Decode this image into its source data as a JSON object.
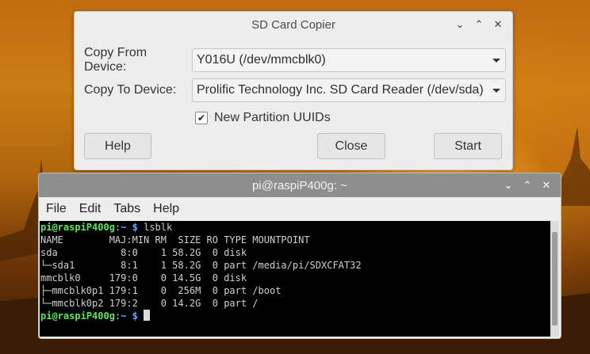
{
  "dialog": {
    "title": "SD Card Copier",
    "from_label": "Copy From Device:",
    "from_value": "Y016U  (/dev/mmcblk0)",
    "to_label": "Copy To Device:",
    "to_value": "Prolific Technology Inc. SD Card Reader  (/dev/sda)",
    "checkbox_label": "New Partition UUIDs",
    "checkbox_checked": true,
    "help_label": "Help",
    "close_label": "Close",
    "start_label": "Start"
  },
  "terminal": {
    "title": "pi@raspiP400g: ~",
    "menu": [
      "File",
      "Edit",
      "Tabs",
      "Help"
    ],
    "prompt_user": "pi@raspiP400g",
    "prompt_path": "~",
    "prompt_sep": ":",
    "prompt_char": "$",
    "command": "lsblk",
    "output_lines": [
      "NAME        MAJ:MIN RM  SIZE RO TYPE MOUNTPOINT",
      "sda           8:0    1 58.2G  0 disk",
      "└─sda1        8:1    1 58.2G  0 part /media/pi/SDXCFAT32",
      "mmcblk0     179:0    0 14.5G  0 disk",
      "├─mmcblk0p1 179:1    0  256M  0 part /boot",
      "└─mmcblk0p2 179:2    0 14.2G  0 part /"
    ]
  },
  "window_controls": {
    "minimize_icon": "chevron-down-icon",
    "maximize_icon": "chevron-up-icon",
    "close_icon": "close-icon"
  }
}
